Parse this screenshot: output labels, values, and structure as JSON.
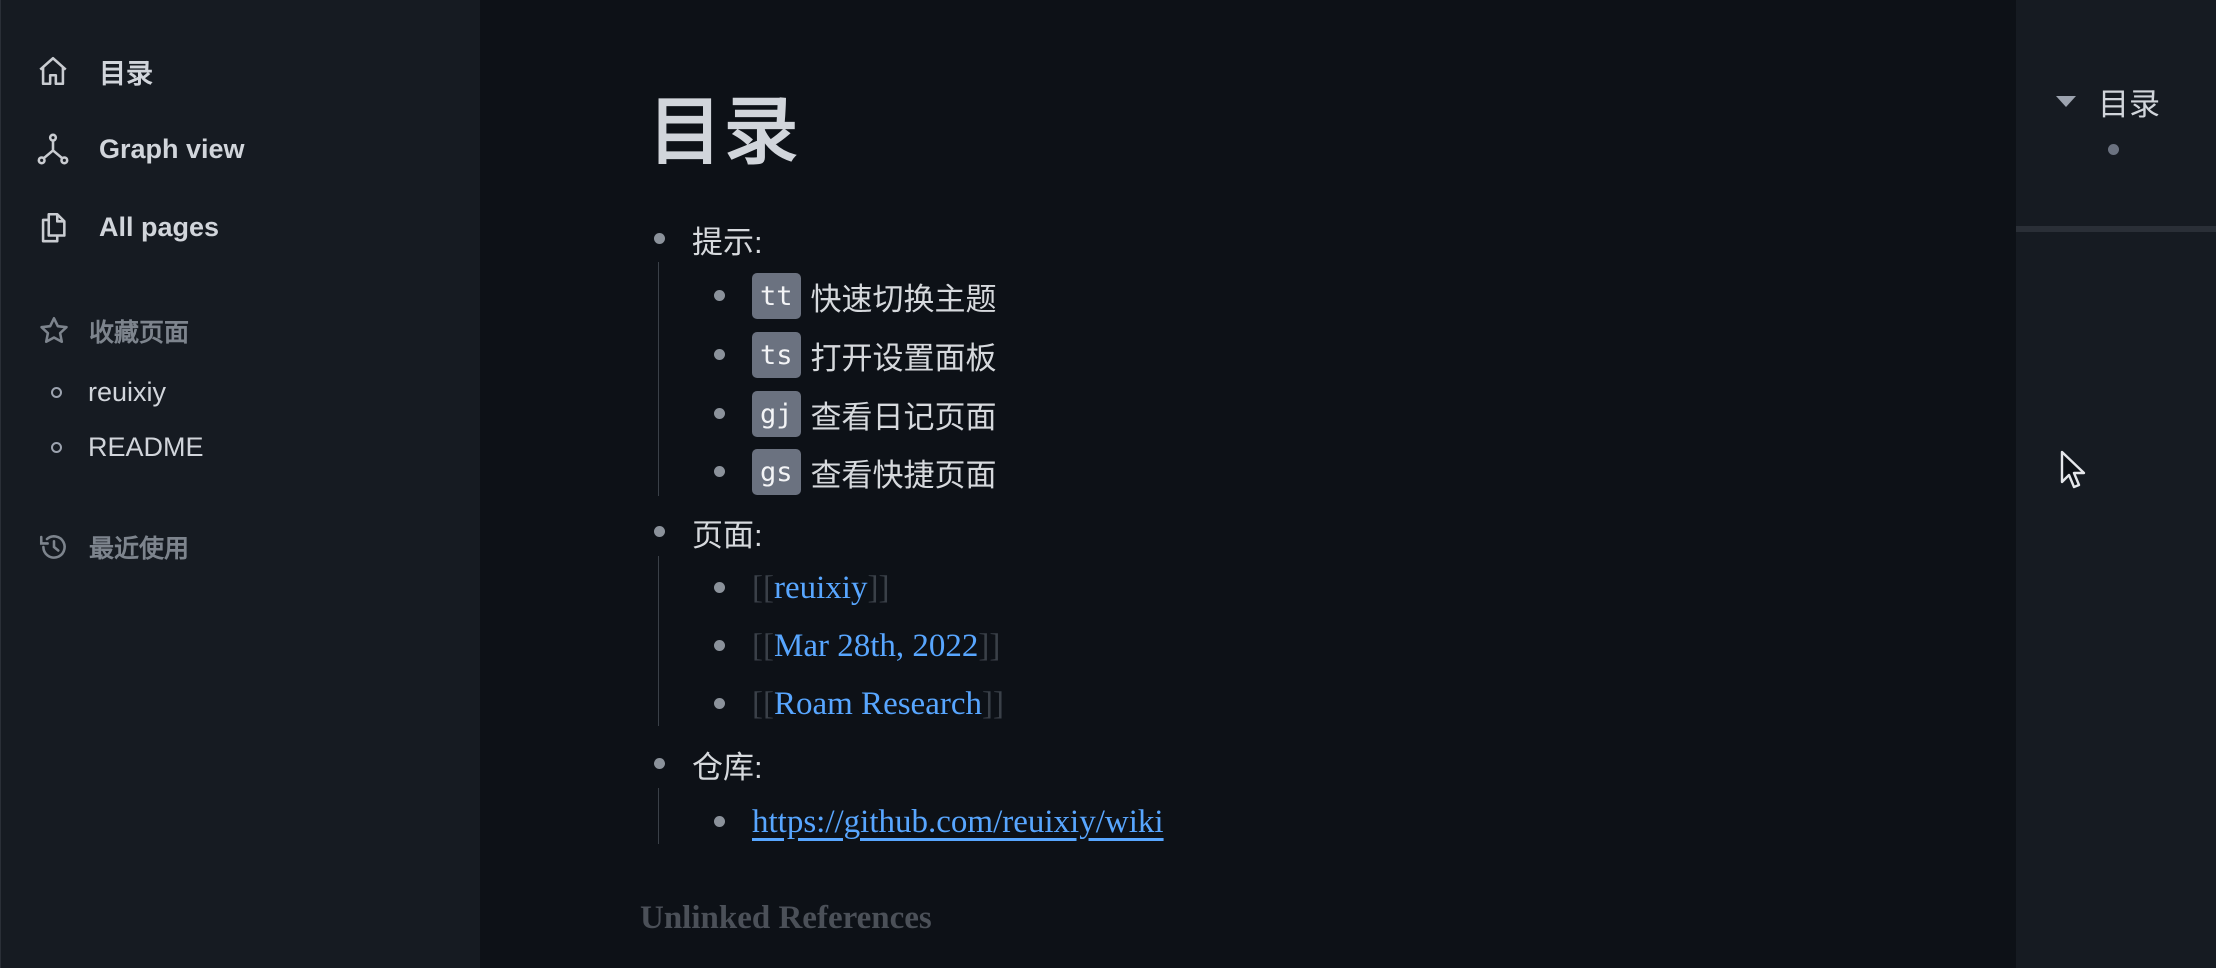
{
  "sidebar": {
    "nav": [
      {
        "label": "目录",
        "icon": "home-icon"
      },
      {
        "label": "Graph view",
        "icon": "graph-icon"
      },
      {
        "label": "All pages",
        "icon": "pages-icon"
      }
    ],
    "favorites": {
      "title": "收藏页面",
      "icon": "star-icon",
      "items": [
        "reuixiy",
        "README"
      ]
    },
    "recent": {
      "title": "最近使用",
      "icon": "history-icon"
    }
  },
  "page": {
    "title": "目录",
    "tips": {
      "label": "提示:",
      "items": [
        {
          "key": "tt",
          "text": "快速切换主题"
        },
        {
          "key": "ts",
          "text": "打开设置面板"
        },
        {
          "key": "gj",
          "text": "查看日记页面"
        },
        {
          "key": "gs",
          "text": "查看快捷页面"
        }
      ]
    },
    "pages": {
      "label": "页面:",
      "links": [
        "reuixiy",
        "Mar 28th, 2022",
        "Roam Research"
      ],
      "bracket_open": "[[",
      "bracket_close": "]]"
    },
    "repo": {
      "label": "仓库:",
      "url": "https://github.com/reuixiy/wiki"
    },
    "unlinked_references": "Unlinked References"
  },
  "right_panel": {
    "toc_title": "目录"
  },
  "colors": {
    "background": "#0d1117",
    "sidebar": "#161b22",
    "link": "#58a6ff",
    "kbd": "#6b7280"
  }
}
